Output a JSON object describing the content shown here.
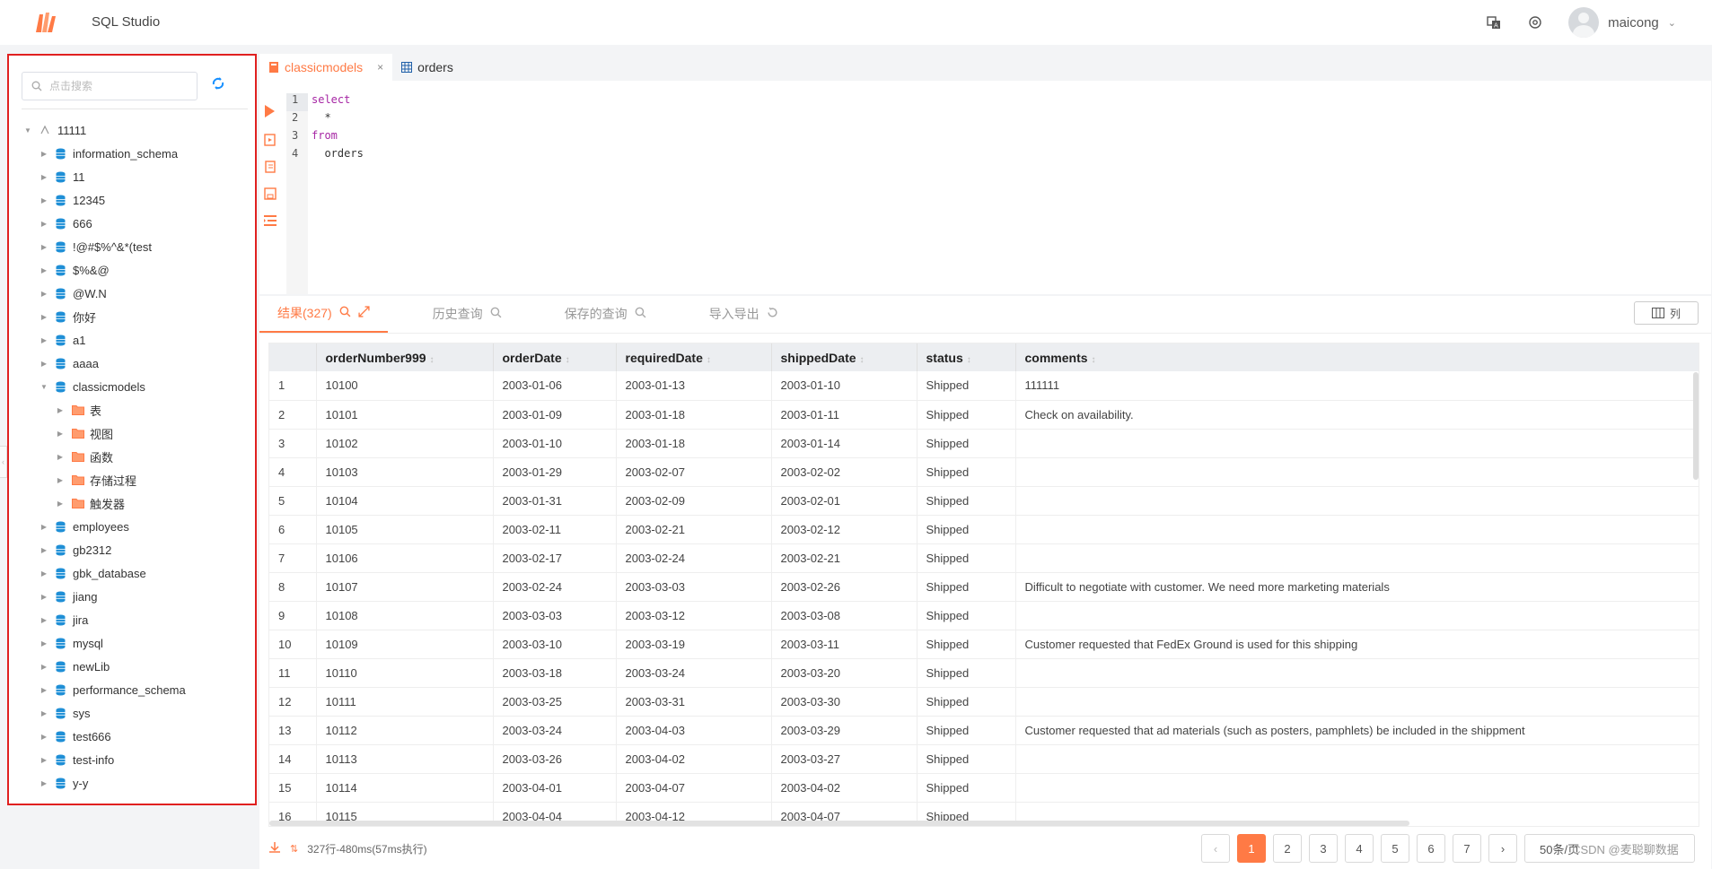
{
  "header": {
    "app_title": "SQL Studio",
    "username": "maicong"
  },
  "sidebar": {
    "search_placeholder": "点击搜索",
    "root": "11111",
    "databases": [
      "information_schema",
      "11",
      "12345",
      "666",
      "!@#$%^&*(test",
      "$%&@",
      "@W.N",
      "你好",
      "a1",
      "aaaa",
      "classicmodels"
    ],
    "classicmodels_children": [
      "表",
      "视图",
      "函数",
      "存储过程",
      "触发器"
    ],
    "databases_after": [
      "employees",
      "gb2312",
      "gbk_database",
      "jiang",
      "jira",
      "mysql",
      "newLib",
      "performance_schema",
      "sys",
      "test666",
      "test-info",
      "y-y"
    ]
  },
  "tabs": [
    {
      "label": "classicmodels",
      "active": true
    },
    {
      "label": "orders",
      "active": false
    }
  ],
  "editor": {
    "lines": [
      {
        "num": "1",
        "text": "select",
        "kind": "kw"
      },
      {
        "num": "2",
        "text": "  *",
        "kind": "plain"
      },
      {
        "num": "3",
        "text": "from",
        "kind": "kw"
      },
      {
        "num": "4",
        "text": "  orders",
        "kind": "plain"
      }
    ]
  },
  "result_tabs": [
    {
      "label": "结果(327)",
      "active": true
    },
    {
      "label": "历史查询",
      "active": false
    },
    {
      "label": "保存的查询",
      "active": false
    },
    {
      "label": "导入导出",
      "active": false
    }
  ],
  "columns_button": "列",
  "table": {
    "headers": [
      "orderNumber999",
      "orderDate",
      "requiredDate",
      "shippedDate",
      "status",
      "comments"
    ],
    "rows": [
      [
        "1",
        "10100",
        "2003-01-06",
        "2003-01-13",
        "2003-01-10",
        "Shipped",
        "111111"
      ],
      [
        "2",
        "10101",
        "2003-01-09",
        "2003-01-18",
        "2003-01-11",
        "Shipped",
        "Check on availability."
      ],
      [
        "3",
        "10102",
        "2003-01-10",
        "2003-01-18",
        "2003-01-14",
        "Shipped",
        ""
      ],
      [
        "4",
        "10103",
        "2003-01-29",
        "2003-02-07",
        "2003-02-02",
        "Shipped",
        ""
      ],
      [
        "5",
        "10104",
        "2003-01-31",
        "2003-02-09",
        "2003-02-01",
        "Shipped",
        ""
      ],
      [
        "6",
        "10105",
        "2003-02-11",
        "2003-02-21",
        "2003-02-12",
        "Shipped",
        ""
      ],
      [
        "7",
        "10106",
        "2003-02-17",
        "2003-02-24",
        "2003-02-21",
        "Shipped",
        ""
      ],
      [
        "8",
        "10107",
        "2003-02-24",
        "2003-03-03",
        "2003-02-26",
        "Shipped",
        "Difficult to negotiate with customer. We need more marketing materials"
      ],
      [
        "9",
        "10108",
        "2003-03-03",
        "2003-03-12",
        "2003-03-08",
        "Shipped",
        ""
      ],
      [
        "10",
        "10109",
        "2003-03-10",
        "2003-03-19",
        "2003-03-11",
        "Shipped",
        "Customer requested that FedEx Ground is used for this shipping"
      ],
      [
        "11",
        "10110",
        "2003-03-18",
        "2003-03-24",
        "2003-03-20",
        "Shipped",
        ""
      ],
      [
        "12",
        "10111",
        "2003-03-25",
        "2003-03-31",
        "2003-03-30",
        "Shipped",
        ""
      ],
      [
        "13",
        "10112",
        "2003-03-24",
        "2003-04-03",
        "2003-03-29",
        "Shipped",
        "Customer requested that ad materials (such as posters, pamphlets) be included in the shippment"
      ],
      [
        "14",
        "10113",
        "2003-03-26",
        "2003-04-02",
        "2003-03-27",
        "Shipped",
        ""
      ],
      [
        "15",
        "10114",
        "2003-04-01",
        "2003-04-07",
        "2003-04-02",
        "Shipped",
        ""
      ],
      [
        "16",
        "10115",
        "2003-04-04",
        "2003-04-12",
        "2003-04-07",
        "Shipped",
        ""
      ]
    ]
  },
  "footer": {
    "status_text": "327行-480ms(57ms执行)",
    "pages": [
      "1",
      "2",
      "3",
      "4",
      "5",
      "6",
      "7"
    ],
    "page_size": "50条/页",
    "watermark": "CSDN @麦聪聊数据"
  },
  "colors": {
    "accent": "#ff7a45",
    "highlight_border": "#e02020",
    "link": "#1890ff"
  }
}
